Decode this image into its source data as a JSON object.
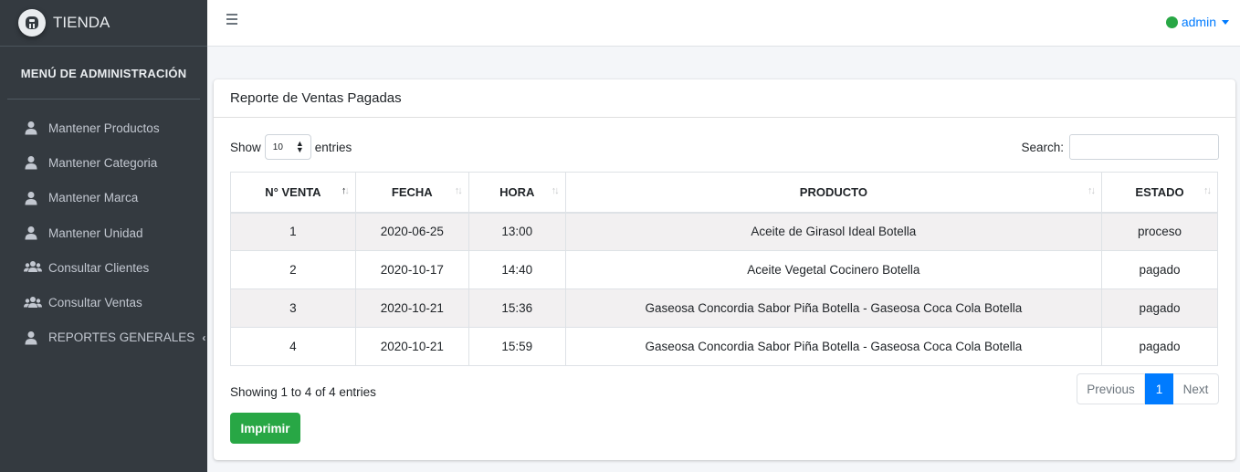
{
  "brand": {
    "name": "TIENDA",
    "logo_icon": "brand-logo-icon"
  },
  "sidebar": {
    "header": "MENÚ DE ADMINISTRACIÓN",
    "items": [
      {
        "label": "Mantener Productos",
        "icon": "user-icon"
      },
      {
        "label": "Mantener Categoria",
        "icon": "user-icon"
      },
      {
        "label": "Mantener Marca",
        "icon": "user-icon"
      },
      {
        "label": "Mantener Unidad",
        "icon": "user-icon"
      },
      {
        "label": "Consultar Clientes",
        "icon": "users-icon"
      },
      {
        "label": "Consultar Ventas",
        "icon": "users-icon"
      },
      {
        "label": "REPORTES GENERALES",
        "icon": "user-icon",
        "chevron": "‹"
      }
    ]
  },
  "topbar": {
    "user": "admin",
    "status_color": "#28a745"
  },
  "card": {
    "title": "Reporte de Ventas Pagadas"
  },
  "controls": {
    "show_label": "Show",
    "page_size": "10",
    "entries_label": "entries",
    "search_label": "Search:",
    "search_value": ""
  },
  "table": {
    "columns": [
      "N° VENTA",
      "FECHA",
      "HORA",
      "PRODUCTO",
      "ESTADO"
    ],
    "rows": [
      [
        "1",
        "2020-06-25",
        "13:00",
        "Aceite de Girasol Ideal Botella",
        "proceso"
      ],
      [
        "2",
        "2020-10-17",
        "14:40",
        "Aceite Vegetal Cocinero Botella",
        "pagado"
      ],
      [
        "3",
        "2020-10-21",
        "15:36",
        "Gaseosa Concordia Sabor Piña Botella - Gaseosa Coca Cola Botella",
        "pagado"
      ],
      [
        "4",
        "2020-10-21",
        "15:59",
        "Gaseosa Concordia Sabor Piña Botella - Gaseosa Coca Cola Botella",
        "pagado"
      ]
    ]
  },
  "footer": {
    "info": "Showing 1 to 4 of 4 entries",
    "prev": "Previous",
    "current_page": "1",
    "next": "Next",
    "print": "Imprimir"
  },
  "colors": {
    "sidebar": "#343a40",
    "accent": "#007bff",
    "success": "#28a745"
  }
}
